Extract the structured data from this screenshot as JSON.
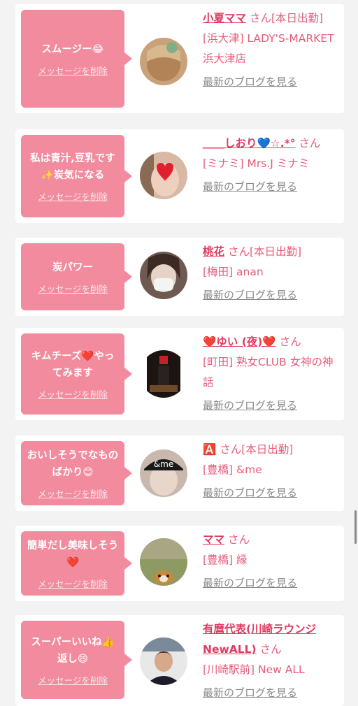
{
  "delete_label": "メッセージを削除",
  "blog_label": "最新のブログを見る",
  "accent_color": "#f28b9d",
  "items": [
    {
      "message": "スムージー😂",
      "name": "小夏ママ",
      "suffix": "さん[本日出勤]",
      "shop": "[浜大津] LADY'S-MARKET 浜大津店",
      "avatar": "blonde-hair-avatar"
    },
    {
      "message": "私は青汁,豆乳です✨炭気になる",
      "name": "＿＿しおり💙☆.*°",
      "suffix": "さん",
      "shop": "[ミナミ] Mrs.J ミナミ",
      "avatar": "heart-face-avatar"
    },
    {
      "message": "炭パワー",
      "name": "桃花",
      "suffix": "さん[本日出勤]",
      "shop": "[梅田] anan",
      "avatar": "masked-woman-avatar"
    },
    {
      "message": "キムチーズ❤️やってみます",
      "name": "❤️ゆい (夜)❤️",
      "suffix": "さん",
      "shop": "[町田] 熟女CLUB 女神の神話",
      "avatar": "dark-room-avatar"
    },
    {
      "message": "おいしそうでなものばかり😊",
      "name": "🅰️",
      "suffix": "さん[本日出勤]",
      "shop": "[豊橋] &me",
      "avatar": "andme-cap-avatar"
    },
    {
      "message": "簡単だし美味しそう❤️",
      "name": "ママ",
      "suffix": "さん",
      "shop": "[豊橋] 縁",
      "avatar": "dog-grass-avatar"
    },
    {
      "message": "スーパーいいね👍返し😄",
      "name": "有麿代表(川崎ラウンジNewALL)",
      "suffix": "さん",
      "shop": "[川崎駅前] New ALL",
      "avatar": "man-suit-avatar"
    }
  ]
}
